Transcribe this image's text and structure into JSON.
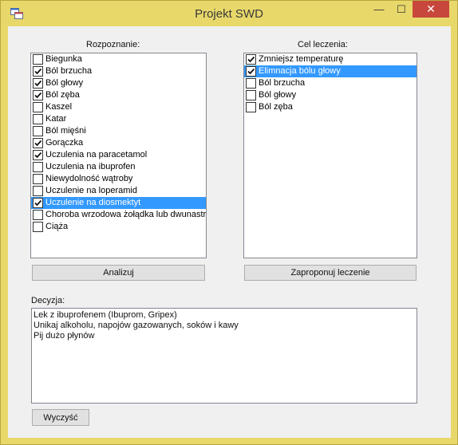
{
  "window": {
    "title": "Projekt SWD",
    "min_glyph": "—",
    "max_glyph": "☐",
    "close_glyph": "✕"
  },
  "diagnosis": {
    "label": "Rozpoznanie:",
    "items": [
      {
        "label": "Biegunka",
        "checked": false,
        "selected": false
      },
      {
        "label": "Ból brzucha",
        "checked": true,
        "selected": false
      },
      {
        "label": "Ból głowy",
        "checked": true,
        "selected": false
      },
      {
        "label": "Ból zęba",
        "checked": true,
        "selected": false
      },
      {
        "label": "Kaszel",
        "checked": false,
        "selected": false
      },
      {
        "label": "Katar",
        "checked": false,
        "selected": false
      },
      {
        "label": "Ból mięśni",
        "checked": false,
        "selected": false
      },
      {
        "label": "Gorączka",
        "checked": true,
        "selected": false
      },
      {
        "label": "Uczulenia na paracetamol",
        "checked": true,
        "selected": false
      },
      {
        "label": "Uczulenia na ibuprofen",
        "checked": false,
        "selected": false
      },
      {
        "label": "Niewydolność wątroby",
        "checked": false,
        "selected": false
      },
      {
        "label": "Uczulenie na loperamid",
        "checked": false,
        "selected": false
      },
      {
        "label": "Uczulenie na diosmektyt",
        "checked": true,
        "selected": true
      },
      {
        "label": "Choroba wrzodowa żołądka lub dwunastr",
        "checked": false,
        "selected": false
      },
      {
        "label": "Ciąża",
        "checked": false,
        "selected": false
      }
    ],
    "button_label": "Analizuj"
  },
  "treatment": {
    "label": "Cel leczenia:",
    "items": [
      {
        "label": "Zmniejsz temperaturę",
        "checked": true,
        "selected": false
      },
      {
        "label": "Elimnacja bólu głowy",
        "checked": true,
        "selected": true
      },
      {
        "label": "Ból brzucha",
        "checked": false,
        "selected": false
      },
      {
        "label": "Ból głowy",
        "checked": false,
        "selected": false
      },
      {
        "label": "Ból zęba",
        "checked": false,
        "selected": false
      }
    ],
    "button_label": "Zaproponuj leczenie"
  },
  "decision": {
    "label": "Decyzja:",
    "lines": [
      "Lek z ibuprofenem (Ibuprom, Gripex)",
      "Unikaj alkoholu, napojów gazowanych, soków i kawy",
      "Pij dużo płynów"
    ]
  },
  "clear_button_label": "Wyczyść",
  "colors": {
    "frame": "#e8d86a",
    "selection": "#3399ff",
    "close": "#c7473c"
  }
}
